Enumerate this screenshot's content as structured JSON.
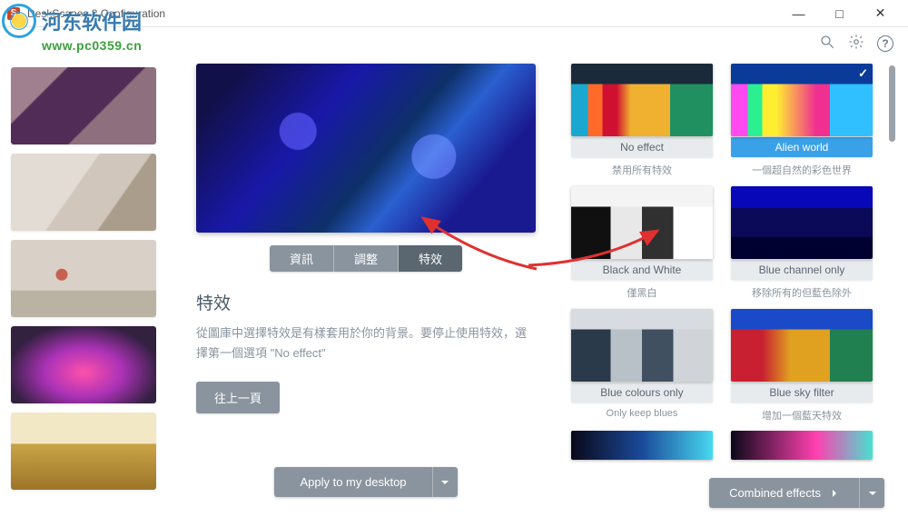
{
  "window": {
    "title": "DeskScapes 8 Configuration",
    "min": "—",
    "max": "□",
    "close": "✕"
  },
  "watermark": {
    "title": "河东软件园",
    "url": "www.pc0359.cn"
  },
  "tabs": {
    "info": "資訊",
    "adjust": "調整",
    "effects": "特效"
  },
  "section": {
    "heading": "特效",
    "description": "從圖庫中選擇特效是有樣套用於你的背景。要停止使用特效，選擇第一個選項 \"No effect\"",
    "back": "往上一頁"
  },
  "apply": {
    "label": "Apply to my desktop"
  },
  "combined": {
    "label": "Combined effects"
  },
  "effects_grid": [
    {
      "name": "No effect",
      "desc": "禁用所有特效",
      "cls": "noeffect",
      "selected": false
    },
    {
      "name": "Alien world",
      "desc": "一個超自然的彩色世界",
      "cls": "alien",
      "selected": true
    },
    {
      "name": "Black and White",
      "desc": "僅黑白",
      "cls": "bw",
      "selected": false
    },
    {
      "name": "Blue channel only",
      "desc": "移除所有的但藍色除外",
      "cls": "bluech",
      "selected": false
    },
    {
      "name": "Blue colours only",
      "desc": "Only keep blues",
      "cls": "bluecol",
      "selected": false
    },
    {
      "name": "Blue sky filter",
      "desc": "增加一個藍天特效",
      "cls": "bluesky",
      "selected": false
    }
  ]
}
